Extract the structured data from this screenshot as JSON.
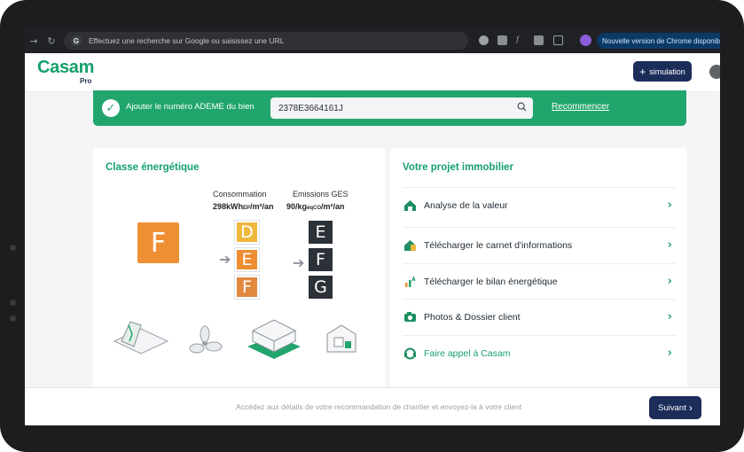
{
  "browser": {
    "omnibox_placeholder": "Effectuez une recherche sur Google ou saisissez une URL",
    "chrome_update": "Nouvelle version de Chrome disponible"
  },
  "header": {
    "logo": "Casam",
    "logo_sub": "Pro",
    "simulation_label": "simulation"
  },
  "ademe": {
    "label": "Ajouter le numéro ADEME du bien",
    "value": "2378E3664161J",
    "reset_label": "Recommencer"
  },
  "energy": {
    "title": "Classe énergétique",
    "current_class": "F",
    "consumption": {
      "heading": "Consommation",
      "value": "298kWh",
      "sub": "EP",
      "unit": "/m²/an",
      "scale": [
        {
          "letter": "D",
          "color": "#f0b73f"
        },
        {
          "letter": "E",
          "color": "#ef8d31"
        },
        {
          "letter": "F",
          "color": "#e0893f"
        }
      ]
    },
    "ges": {
      "heading": "Emissions GES",
      "value": "90/kg",
      "sub": "éqCO",
      "unit": "/m²/an",
      "scale": [
        "E",
        "F",
        "G"
      ]
    }
  },
  "project": {
    "title": "Votre projet immobilier",
    "items": [
      {
        "label": "Analyse de la valeur",
        "icon": "house-value-icon",
        "highlight": false
      },
      {
        "label": "Télécharger le carnet d'informations",
        "icon": "house-document-icon",
        "highlight": false
      },
      {
        "label": "Télécharger le bilan énergétique",
        "icon": "energy-bars-icon",
        "highlight": false
      },
      {
        "label": "Photos & Dossier client",
        "icon": "camera-icon",
        "highlight": false
      },
      {
        "label": "Faire appel à Casam",
        "icon": "support-icon",
        "highlight": true
      }
    ]
  },
  "footer": {
    "text": "Accédez aux détails de votre recommandation de chantier et envoyez-la à votre client",
    "next_label": "Suivant"
  },
  "colors": {
    "brand_green": "#21a56d",
    "navy": "#1c2d5a",
    "energy_orange": "#ef8f33"
  }
}
